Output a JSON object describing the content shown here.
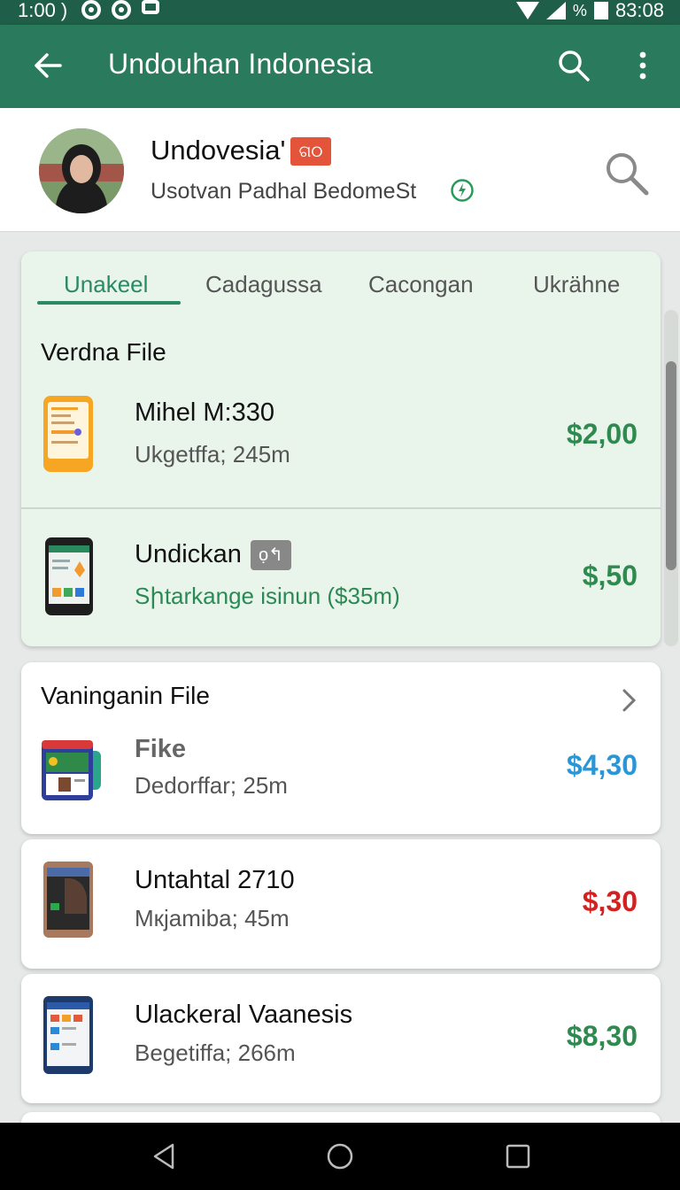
{
  "status_bar": {
    "time": "1:00 )",
    "percent": "%",
    "clock": "83:08"
  },
  "app_bar": {
    "title": "Undouhan Indonesia"
  },
  "profile": {
    "name": "Undovesia'",
    "badge": "ଗ୦",
    "subtitle": "Usotvan Padhal BedomeSt"
  },
  "tabs": [
    {
      "label": "Unakeel",
      "active": true
    },
    {
      "label": "Cadagussa",
      "active": false
    },
    {
      "label": "Cacongan",
      "active": false
    },
    {
      "label": "Ukrähne",
      "active": false
    }
  ],
  "section1": {
    "title": "Verdna File",
    "items": [
      {
        "title": "Mihel M:330",
        "subtitle": "Ukgetffa; 245m",
        "price": "$2,00",
        "price_color": "#2f8a4f"
      },
      {
        "title": "Undickan",
        "badge": "ọ↰",
        "subtitle": "Sիtarkange isinun ($35m)",
        "price": "$,50",
        "price_color": "#2f8a4f"
      }
    ]
  },
  "section2": {
    "title": "Vaninganin File",
    "items": [
      {
        "title": "Fike",
        "subtitle": "Dedorffar; 25m",
        "price": "$4,30",
        "price_color": "#2996d8"
      }
    ]
  },
  "cards": [
    {
      "title": "Untahtal 2710",
      "subtitle": "Mкjamiba; 45m",
      "price": "$,30",
      "price_color": "#d42020"
    },
    {
      "title": "Ulackeral Vaanesis",
      "subtitle": "Begetiffa; 266m",
      "price": "$8,30",
      "price_color": "#2f8a4f"
    }
  ],
  "icons": [
    "back-arrow-icon",
    "search-icon",
    "more-vert-icon",
    "verified-icon",
    "chevron-right-icon",
    "nav-back-icon",
    "nav-home-icon",
    "nav-recents-icon"
  ],
  "colors": {
    "primary": "#2a7a5e",
    "statusbar": "#1f5e48",
    "accent_green": "#2a8a62"
  }
}
